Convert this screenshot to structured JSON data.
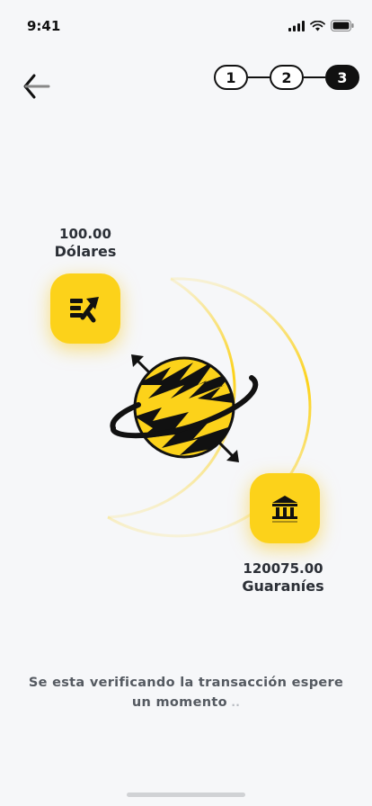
{
  "status_bar": {
    "time": "9:41"
  },
  "nav": {
    "back_icon": "arrow-left-icon"
  },
  "stepper": {
    "steps": [
      "1",
      "2",
      "3"
    ],
    "active_step": 3
  },
  "from": {
    "amount": "100.00",
    "currency": "Dólares",
    "icon": "send-money-icon"
  },
  "to": {
    "amount": "120075.00",
    "currency": "Guaraníes",
    "icon": "bank-icon"
  },
  "message": {
    "text": "Se esta verificando la transacción espere un momento",
    "dots": " .."
  },
  "colors": {
    "accent": "#fcd21a",
    "dark": "#111111",
    "background": "#f6f7f9"
  }
}
